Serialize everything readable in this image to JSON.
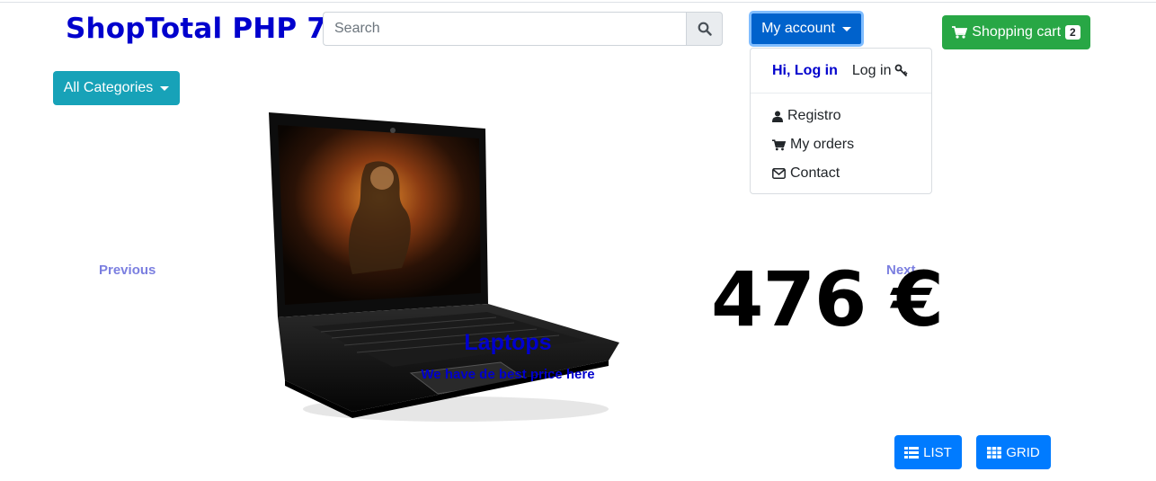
{
  "brand": {
    "title": "ShopTotal PHP 7"
  },
  "search": {
    "placeholder": "Search",
    "icon": "search-icon"
  },
  "account": {
    "button_label": "My account",
    "dropdown": {
      "greeting": "Hi, Log in",
      "login_label": "Log in",
      "items": [
        {
          "label": "Registro",
          "icon": "user-icon"
        },
        {
          "label": "My orders",
          "icon": "cart-icon"
        },
        {
          "label": "Contact",
          "icon": "envelope-icon"
        }
      ]
    }
  },
  "cart": {
    "label": "Shopping cart",
    "count": "2"
  },
  "categories": {
    "button_label": "All Categories"
  },
  "carousel": {
    "prev_label": "Previous",
    "next_label": "Next",
    "price": "476 €",
    "caption_title": "Laptops",
    "caption_subtitle": "We have de best price here"
  },
  "view": {
    "list_label": "LIST",
    "grid_label": "GRID"
  },
  "colors": {
    "brand": "#0000cd",
    "primary": "#007bff",
    "success": "#28a745",
    "info": "#17a2b8"
  }
}
